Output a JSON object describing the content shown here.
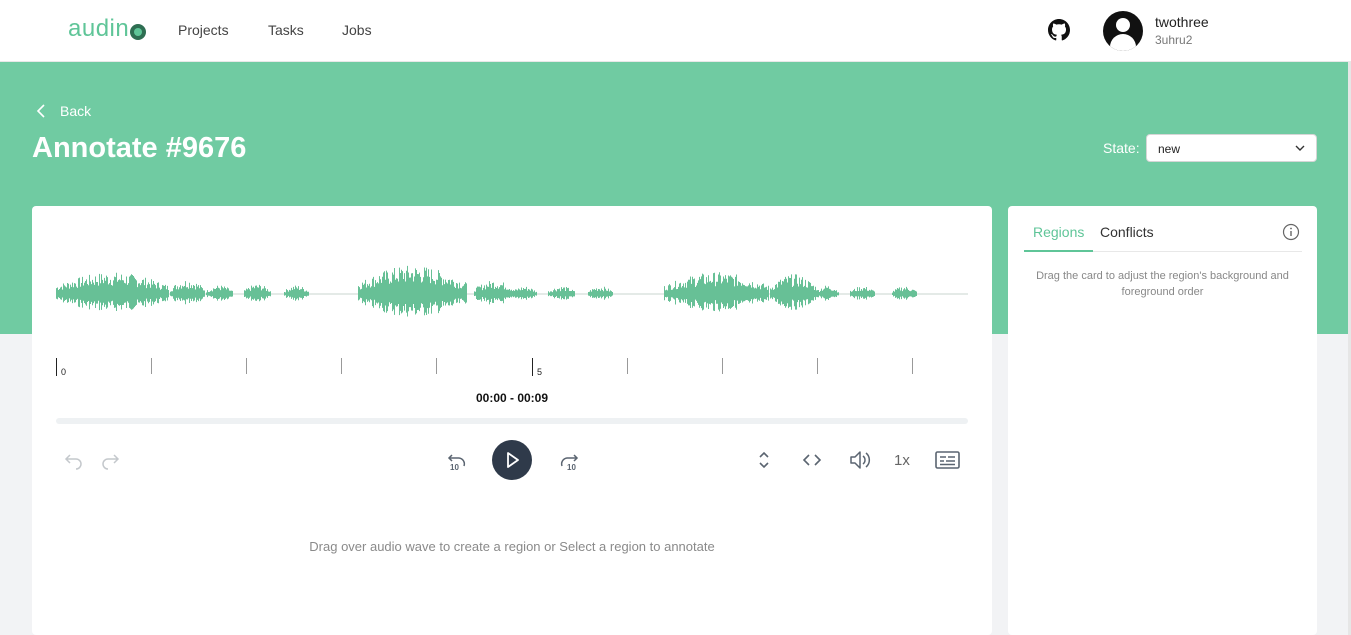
{
  "app": {
    "logo_text": "audin"
  },
  "nav": {
    "items": [
      "Projects",
      "Tasks",
      "Jobs"
    ]
  },
  "user": {
    "name": "twothree",
    "tag": "3uhru2"
  },
  "header": {
    "back_label": "Back",
    "title": "Annotate #9676",
    "state_label": "State:",
    "state_value": "new"
  },
  "player": {
    "time_range": "00:00 - 00:09",
    "tick_labels": [
      "0",
      "5"
    ],
    "speed": "1x",
    "hint": "Drag over audio wave to create a region or Select a region to annotate"
  },
  "sidebar": {
    "tabs": [
      "Regions",
      "Conflicts"
    ],
    "active_tab": "Regions",
    "hint": "Drag the card to adjust the region's background and foreground order"
  },
  "colors": {
    "accent": "#5fc598",
    "band": "#70cba2",
    "wave": "#67c096",
    "play_button": "#2f3a4a"
  }
}
